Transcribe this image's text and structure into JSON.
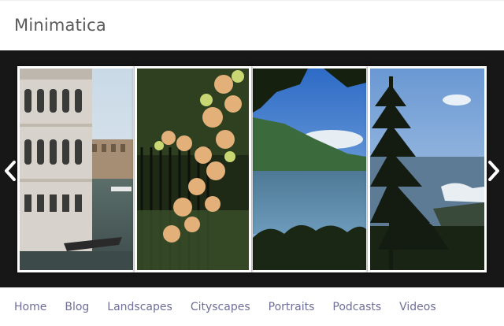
{
  "site": {
    "title": "Minimatica"
  },
  "slider": {
    "slides": [
      {
        "subject": "venice-palace-canal"
      },
      {
        "subject": "autumn-leaves-fence"
      },
      {
        "subject": "mountain-lake"
      },
      {
        "subject": "seaside-pine-tree"
      }
    ],
    "prev_icon": "chevron-left-icon",
    "next_icon": "chevron-right-icon"
  },
  "nav": {
    "items": [
      {
        "label": "Home"
      },
      {
        "label": "Blog"
      },
      {
        "label": "Landscapes"
      },
      {
        "label": "Cityscapes"
      },
      {
        "label": "Portraits"
      },
      {
        "label": "Podcasts"
      },
      {
        "label": "Videos"
      }
    ]
  },
  "colors": {
    "slider_background": "#171717",
    "nav_link": "#6e6e9a",
    "title": "#5a5a5a"
  }
}
